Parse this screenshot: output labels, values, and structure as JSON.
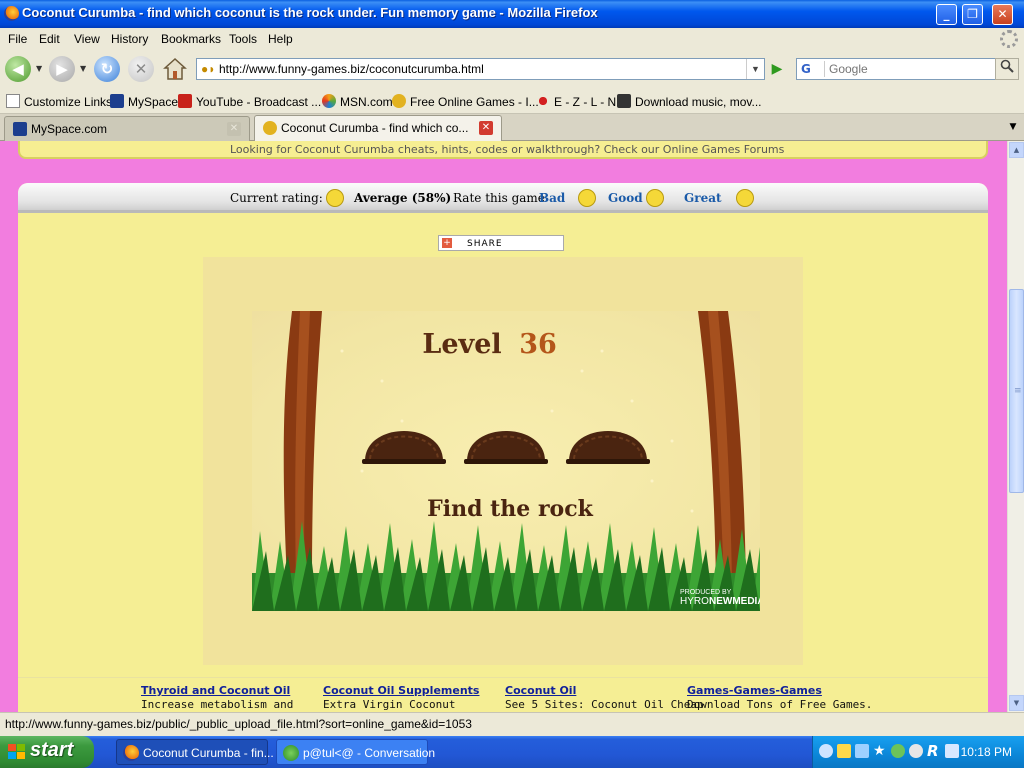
{
  "window": {
    "title": "Coconut Curumba - find which coconut is the rock under. Fun memory game - Mozilla Firefox",
    "minimize": "_",
    "maximize": "❐",
    "close": "✕"
  },
  "menubar": {
    "items": [
      "File",
      "Edit",
      "View",
      "History",
      "Bookmarks",
      "Tools",
      "Help"
    ]
  },
  "navbar": {
    "url": "http://www.funny-games.biz/coconutcurumba.html",
    "search_engine": "G",
    "search_placeholder": "Google"
  },
  "bookmarks": {
    "items": [
      "Customize Links",
      "MySpace",
      "YouTube - Broadcast ...",
      "MSN.com",
      "Free Online Games - I...",
      "E - Z - L - N",
      "Download music, mov..."
    ]
  },
  "tabs": [
    {
      "label": "MySpace.com",
      "active": false
    },
    {
      "label": "Coconut Curumba - find which co...",
      "active": true
    }
  ],
  "page": {
    "top_cut_text": "Looking for Coconut Curumba cheats, hints, codes or walkthrough? Check our Online Games Forums",
    "rating": {
      "current_label": "Current rating:",
      "value": "Average (58%)",
      "rate_label": "Rate this game",
      "bad": "Bad",
      "good": "Good",
      "great": "Great"
    },
    "share_label": "SHARE",
    "game": {
      "level_word": "Level",
      "level_number": "36",
      "instruction": "Find the rock",
      "produced_by": "PRODUCED BY",
      "brand_a": "HYRO",
      "brand_b": "NEWMEDIA",
      "coconut_count": 3
    },
    "ad_links": [
      {
        "title": "Thyroid and Coconut Oil",
        "desc": "Increase metabolism and"
      },
      {
        "title": "Coconut Oil Supplements",
        "desc": "Extra Virgin Coconut"
      },
      {
        "title": "Coconut Oil",
        "desc": "See 5 Sites: Coconut Oil Cheap"
      },
      {
        "title": "Games-Games-Games",
        "desc": "Download Tons of Free Games."
      }
    ]
  },
  "statusbar": {
    "text": "http://www.funny-games.biz/public/_public_upload_file.html?sort=online_game&id=1053"
  },
  "taskbar": {
    "start": "start",
    "buttons": [
      {
        "label": "Coconut Curumba - fin...",
        "active": true
      },
      {
        "label": "p@tul<@ - Conversation",
        "active": false
      }
    ],
    "clock": "10:18 PM"
  },
  "colors": {
    "page_bg": "#f27ddf",
    "game_bg": "#f5ee94",
    "link_blue": "#10209a",
    "rating_link": "#1a5aa8"
  }
}
